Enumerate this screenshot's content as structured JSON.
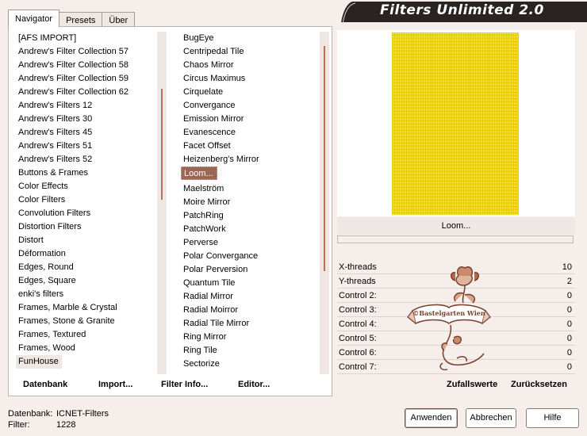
{
  "tabs": [
    "Navigator",
    "Presets",
    "Über"
  ],
  "app_title": "Filters Unlimited 2.0",
  "categories": [
    "[AFS IMPORT]",
    "Andrew's Filter Collection 57",
    "Andrew's Filter Collection 58",
    "Andrew's Filter Collection 59",
    "Andrew's Filter Collection 62",
    "Andrew's Filters 12",
    "Andrew's Filters 30",
    "Andrew's Filters 45",
    "Andrew's Filters 51",
    "Andrew's Filters 52",
    "Buttons & Frames",
    "Color Effects",
    "Color Filters",
    "Convolution Filters",
    "Distortion Filters",
    "Distort",
    "Déformation",
    "Edges, Round",
    "Edges, Square",
    "enki's filters",
    "Frames, Marble & Crystal",
    "Frames, Stone & Granite",
    "Frames, Textured",
    "Frames, Wood",
    "FunHouse"
  ],
  "selected_category": "FunHouse",
  "filters": [
    "BugEye",
    "Centripedal Tile",
    "Chaos Mirror",
    "Circus Maximus",
    "Cirquelate",
    "Convergance",
    "Emission Mirror",
    "Evanescence",
    "Facet Offset",
    "Heizenberg's Mirror",
    "Loom...",
    "Maelström",
    "Moire Mirror",
    "PatchRing",
    "PatchWork",
    "Perverse",
    "Polar Convergance",
    "Polar Perversion",
    "Quantum Tile",
    "Radial Mirror",
    "Radial Moirror",
    "Radial Tile Mirror",
    "Ring Mirror",
    "Ring Tile",
    "Sectorize"
  ],
  "selected_filter": "Loom...",
  "current_filter_name": "Loom...",
  "bottom_buttons": {
    "datenbank": "Datenbank",
    "import": "Import...",
    "filter_info": "Filter Info...",
    "editor": "Editor..."
  },
  "params": [
    {
      "name": "X-threads",
      "value": "10"
    },
    {
      "name": "Y-threads",
      "value": "2"
    },
    {
      "name": "Control 2:",
      "value": "0"
    },
    {
      "name": "Control 3:",
      "value": "0"
    },
    {
      "name": "Control 4:",
      "value": "0"
    },
    {
      "name": "Control 5:",
      "value": "0"
    },
    {
      "name": "Control 6:",
      "value": "0"
    },
    {
      "name": "Control 7:",
      "value": "0"
    }
  ],
  "watermark": "©Bastelgarten Wien",
  "random_label": "Zufallswerte",
  "reset_label": "Zurücksetzen",
  "status": {
    "db_label": "Datenbank:",
    "db_value": "ICNET-Filters",
    "filter_label": "Filter:",
    "filter_value": "1228"
  },
  "actions": {
    "apply": "Anwenden",
    "cancel": "Abbrechen",
    "help": "Hilfe"
  },
  "colors": {
    "background": "#f5eeeb",
    "selection": "#9b6654",
    "scroll_thumb": "#b8705a",
    "preview_yellow": "#f1d900",
    "banner": "#2a2324"
  }
}
